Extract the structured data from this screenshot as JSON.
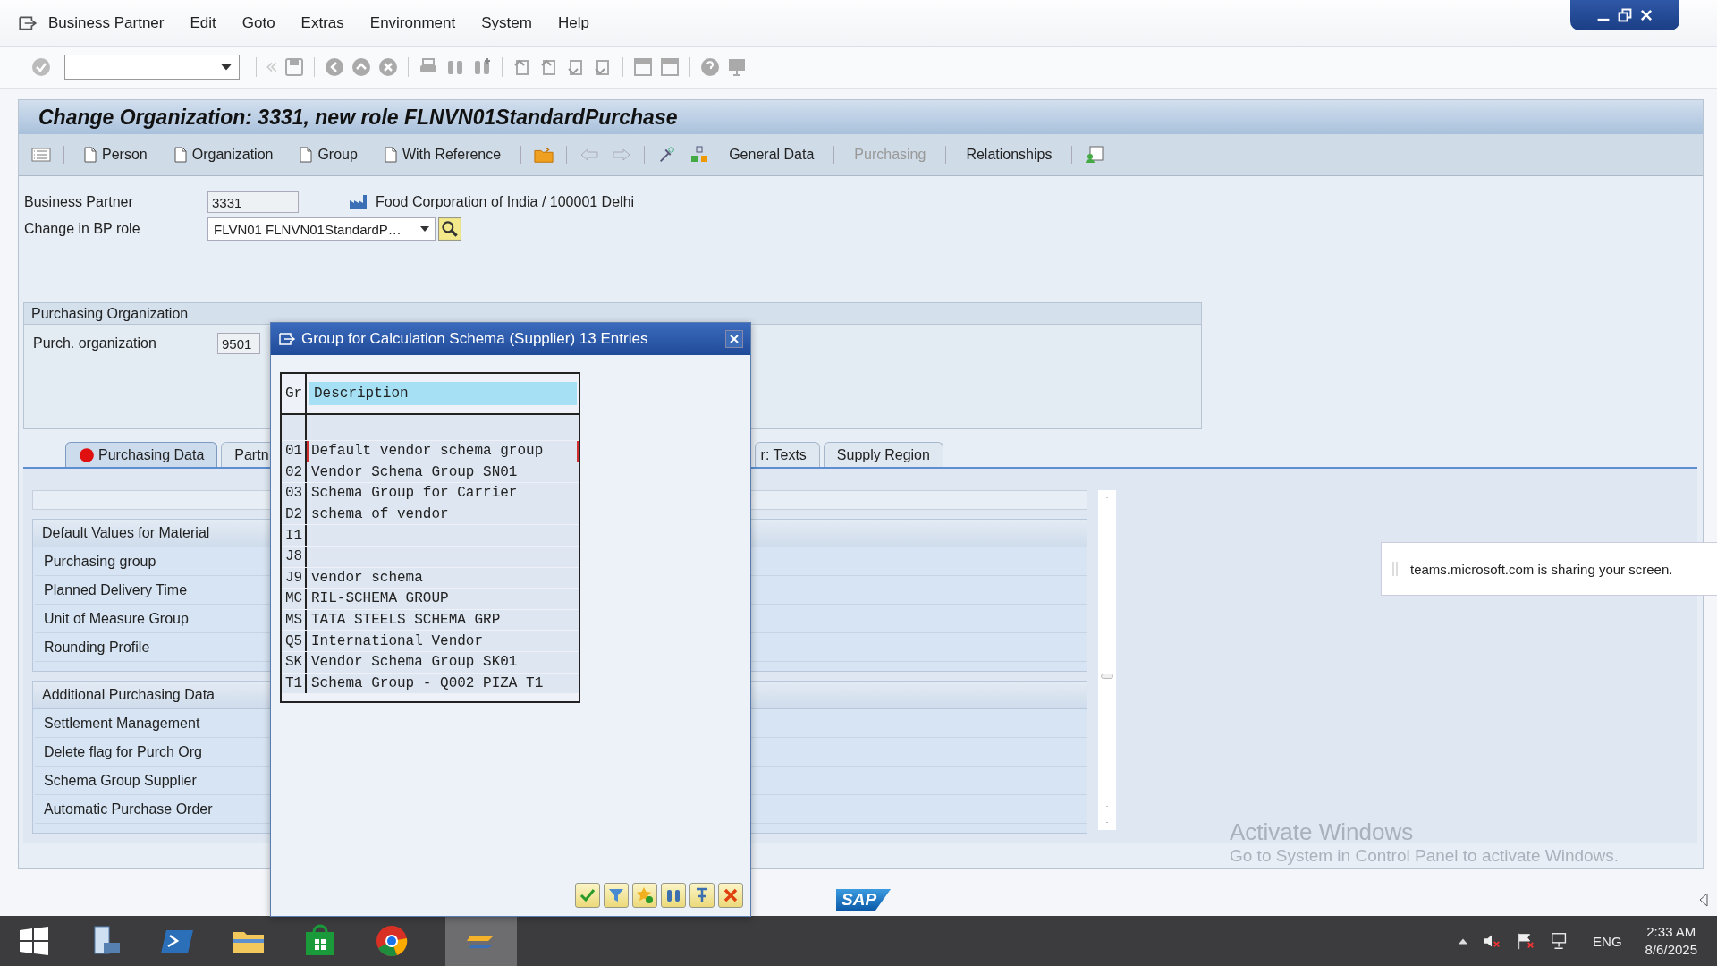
{
  "menu_bar": [
    "Business Partner",
    "Edit",
    "Goto",
    "Extras",
    "Environment",
    "System",
    "Help"
  ],
  "title": "Change Organization: 3331, new role FLNVN01StandardPurchase",
  "app_toolbar": [
    {
      "kind": "create",
      "label": "Person",
      "disabled": false
    },
    {
      "kind": "create",
      "label": "Organization",
      "disabled": false
    },
    {
      "kind": "create",
      "label": "Group",
      "disabled": false
    },
    {
      "kind": "create",
      "label": "With Reference",
      "disabled": false
    },
    {
      "kind": "view",
      "label": "General Data",
      "disabled": false
    },
    {
      "kind": "view",
      "label": "Purchasing",
      "disabled": true
    },
    {
      "kind": "view",
      "label": "Relationships",
      "disabled": false
    }
  ],
  "header_fields": [
    {
      "kind": "text",
      "label": "Business Partner",
      "value": "3331",
      "description": "Food Corporation of India / 100001 Delhi"
    },
    {
      "kind": "dropdown",
      "label": "Change in BP role",
      "value": "FLVN01 FLNVN01StandardP…"
    }
  ],
  "purchasing_org": {
    "title": "Purchasing Organization",
    "label": "Purch. organization",
    "value": "9501"
  },
  "tabs": [
    {
      "label": "Purchasing Data",
      "selected": true,
      "error": true
    },
    {
      "label": "Partn",
      "selected": false,
      "error": false
    },
    {
      "label": "r: Texts",
      "selected": false,
      "error": false
    },
    {
      "label": "Supply Region",
      "selected": false,
      "error": false
    }
  ],
  "sections": [
    {
      "title": "Default Values for Material",
      "fields": [
        "Purchasing group",
        "Planned Delivery Time",
        "Unit of Measure Group",
        "Rounding Profile"
      ]
    },
    {
      "title": "Additional Purchasing Data",
      "fields": [
        "Settlement Management",
        "Delete flag for Purch Org",
        "Schema Group Supplier",
        "Automatic Purchase Order"
      ]
    }
  ],
  "popup": {
    "title": "Group for Calculation Schema (Supplier) 13 Entries",
    "columns": [
      "Gr",
      "Description"
    ],
    "rows": [
      {
        "code": "01",
        "description": "Default vendor schema group",
        "selected": true
      },
      {
        "code": "02",
        "description": "Vendor Schema Group SN01",
        "selected": false
      },
      {
        "code": "03",
        "description": "Schema Group for Carrier",
        "selected": false
      },
      {
        "code": "D2",
        "description": "schema of vendor",
        "selected": false
      },
      {
        "code": "I1",
        "selected": false
      },
      {
        "code": "J8",
        "selected": false
      },
      {
        "code": "J9",
        "description": "vendor schema",
        "selected": false
      },
      {
        "code": "MC",
        "description": "RIL-SCHEMA GROUP",
        "selected": false
      },
      {
        "code": "MS",
        "description": "TATA STEELS SCHEMA GRP",
        "selected": false
      },
      {
        "code": "Q5",
        "description": "International Vendor",
        "selected": false
      },
      {
        "code": "SK",
        "description": "Vendor Schema Group SK01",
        "selected": false
      },
      {
        "code": "T1",
        "description": "Schema Group - Q002 PIZA T1",
        "selected": false
      }
    ]
  },
  "status_bar": {
    "logo": "SAP"
  },
  "notification": "teams.microsoft.com is sharing your screen.",
  "activation": {
    "title": "Activate Windows",
    "subtitle": "Go to System in Control Panel to activate Windows."
  },
  "taskbar": {
    "language": "ENG",
    "time": "2:33 AM",
    "date": "8/6/2025"
  }
}
